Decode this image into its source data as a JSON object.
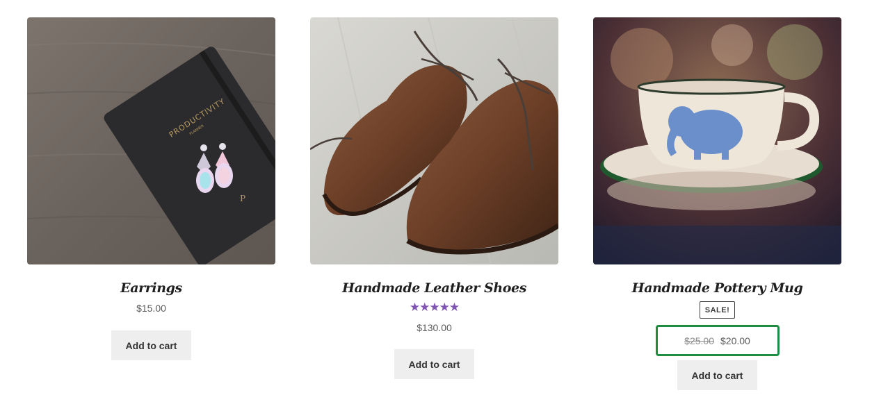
{
  "products": [
    {
      "image_alt": "Earrings",
      "title": "Earrings",
      "price": "$15.00",
      "button_label": "Add to cart"
    },
    {
      "image_alt": "Handmade Leather Shoes",
      "title": "Handmade Leather Shoes",
      "rating_stars": "★★★★★",
      "rating_value": 5,
      "price": "$130.00",
      "button_label": "Add to cart"
    },
    {
      "image_alt": "Handmade Pottery Mug",
      "title": "Handmade Pottery Mug",
      "badge": "SALE!",
      "regular_price": "$25.00",
      "sale_price": "$20.00",
      "button_label": "Add to cart"
    }
  ],
  "colors": {
    "rating_star": "#7f54b3",
    "highlight_box": "#1e8d3f",
    "button_bg": "#eeeeee"
  }
}
